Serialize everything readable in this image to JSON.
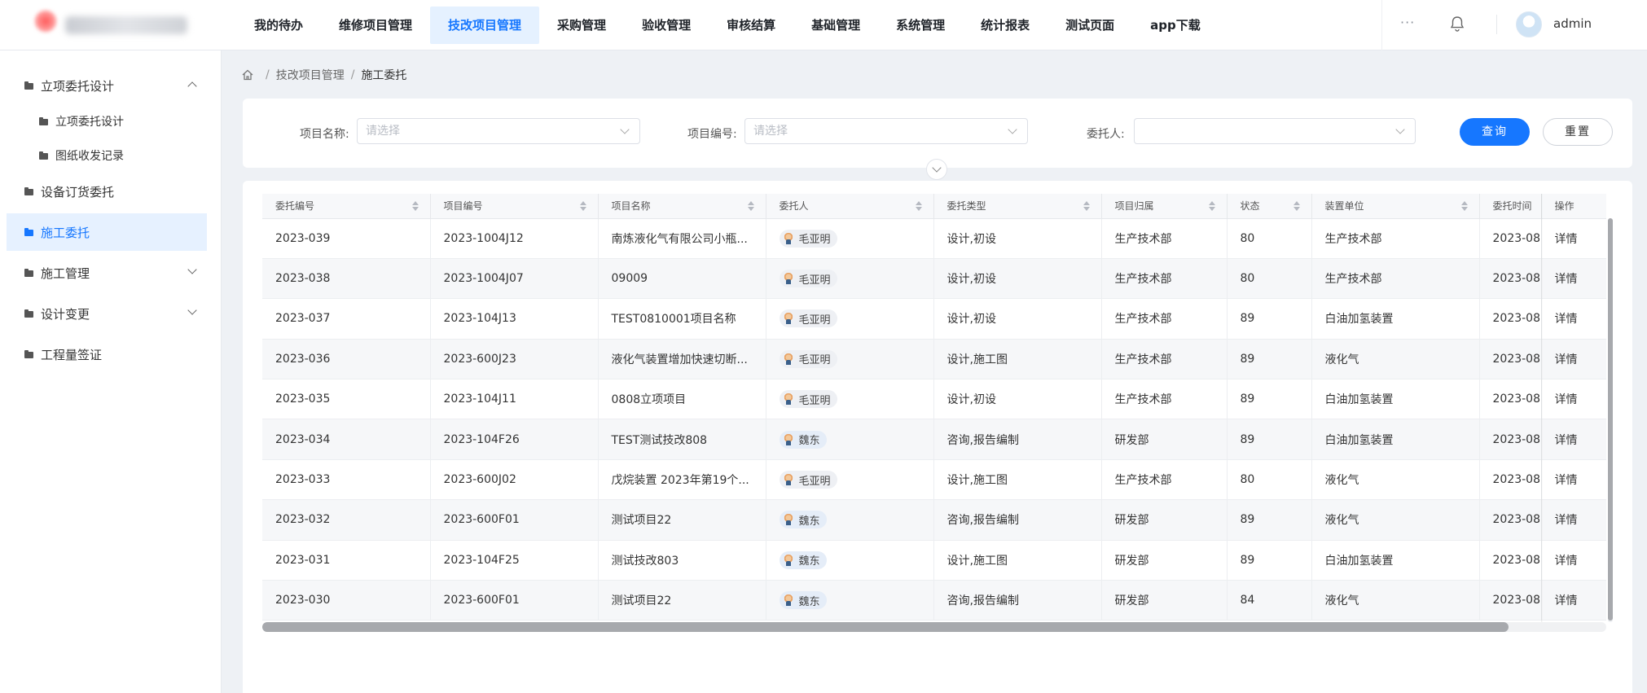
{
  "header": {
    "nav": [
      {
        "label": "我的待办",
        "active": false
      },
      {
        "label": "维修项目管理",
        "active": false
      },
      {
        "label": "技改项目管理",
        "active": true
      },
      {
        "label": "采购管理",
        "active": false
      },
      {
        "label": "验收管理",
        "active": false
      },
      {
        "label": "审核结算",
        "active": false
      },
      {
        "label": "基础管理",
        "active": false
      },
      {
        "label": "系统管理",
        "active": false
      },
      {
        "label": "统计报表",
        "active": false
      },
      {
        "label": "测试页面",
        "active": false
      },
      {
        "label": "app下载",
        "active": false
      }
    ],
    "more": "···",
    "username": "admin"
  },
  "sidebar": {
    "items": [
      {
        "label": "立项委托设计"
      },
      {
        "label": "立项委托设计"
      },
      {
        "label": "图纸收发记录"
      },
      {
        "label": "设备订货委托"
      },
      {
        "label": "施工委托"
      },
      {
        "label": "施工管理"
      },
      {
        "label": "设计变更"
      },
      {
        "label": "工程量签证"
      }
    ]
  },
  "breadcrumb": {
    "parent": "技改项目管理",
    "separator": "/",
    "current": "施工委托"
  },
  "search": {
    "project_name_label": "项目名称:",
    "project_name_placeholder": "请选择",
    "project_no_label": "项目编号:",
    "project_no_placeholder": "请选择",
    "client_label": "委托人:",
    "client_placeholder": "",
    "query_button": "查询",
    "reset_button": "重置"
  },
  "table": {
    "columns": [
      "委托编号",
      "项目编号",
      "项目名称",
      "委托人",
      "委托类型",
      "项目归属",
      "状态",
      "装置单位",
      "委托时间",
      "操作"
    ],
    "rows": [
      {
        "no": "2023-039",
        "pno": "2023-1004J12",
        "name": "南炼液化气有限公司小瓶...",
        "client": "毛亚明",
        "type": "设计,初设",
        "dept": "生产技术部",
        "status": "80",
        "unit": "生产技术部",
        "time": "2023-08",
        "op": "详情"
      },
      {
        "no": "2023-038",
        "pno": "2023-1004J07",
        "name": "09009",
        "client": "毛亚明",
        "type": "设计,初设",
        "dept": "生产技术部",
        "status": "80",
        "unit": "生产技术部",
        "time": "2023-08",
        "op": "详情"
      },
      {
        "no": "2023-037",
        "pno": "2023-104J13",
        "name": "TEST0810001项目名称",
        "client": "毛亚明",
        "type": "设计,初设",
        "dept": "生产技术部",
        "status": "89",
        "unit": "白油加氢装置",
        "time": "2023-08",
        "op": "详情"
      },
      {
        "no": "2023-036",
        "pno": "2023-600J23",
        "name": "液化气装置增加快速切断...",
        "client": "毛亚明",
        "type": "设计,施工图",
        "dept": "生产技术部",
        "status": "89",
        "unit": "液化气",
        "time": "2023-08",
        "op": "详情"
      },
      {
        "no": "2023-035",
        "pno": "2023-104J11",
        "name": "0808立项项目",
        "client": "毛亚明",
        "type": "设计,初设",
        "dept": "生产技术部",
        "status": "89",
        "unit": "白油加氢装置",
        "time": "2023-08",
        "op": "详情"
      },
      {
        "no": "2023-034",
        "pno": "2023-104F26",
        "name": "TEST测试技改808",
        "client": "魏东",
        "type": "咨询,报告编制",
        "dept": "研发部",
        "status": "89",
        "unit": "白油加氢装置",
        "time": "2023-08",
        "op": "详情"
      },
      {
        "no": "2023-033",
        "pno": "2023-600J02",
        "name": "戊烷装置 2023年第19个...",
        "client": "毛亚明",
        "type": "设计,施工图",
        "dept": "生产技术部",
        "status": "80",
        "unit": "液化气",
        "time": "2023-08",
        "op": "详情"
      },
      {
        "no": "2023-032",
        "pno": "2023-600F01",
        "name": "测试项目22",
        "client": "魏东",
        "type": "咨询,报告编制",
        "dept": "研发部",
        "status": "89",
        "unit": "液化气",
        "time": "2023-08",
        "op": "详情"
      },
      {
        "no": "2023-031",
        "pno": "2023-104F25",
        "name": "测试技改803",
        "client": "魏东",
        "type": "设计,施工图",
        "dept": "研发部",
        "status": "89",
        "unit": "白油加氢装置",
        "time": "2023-08",
        "op": "详情"
      },
      {
        "no": "2023-030",
        "pno": "2023-600F01",
        "name": "测试项目22",
        "client": "魏东",
        "type": "咨询,报告编制",
        "dept": "研发部",
        "status": "84",
        "unit": "液化气",
        "time": "2023-08",
        "op": "详情"
      }
    ]
  },
  "colors": {
    "accent": "#1677ff",
    "active_bg": "#e5f1ff"
  }
}
